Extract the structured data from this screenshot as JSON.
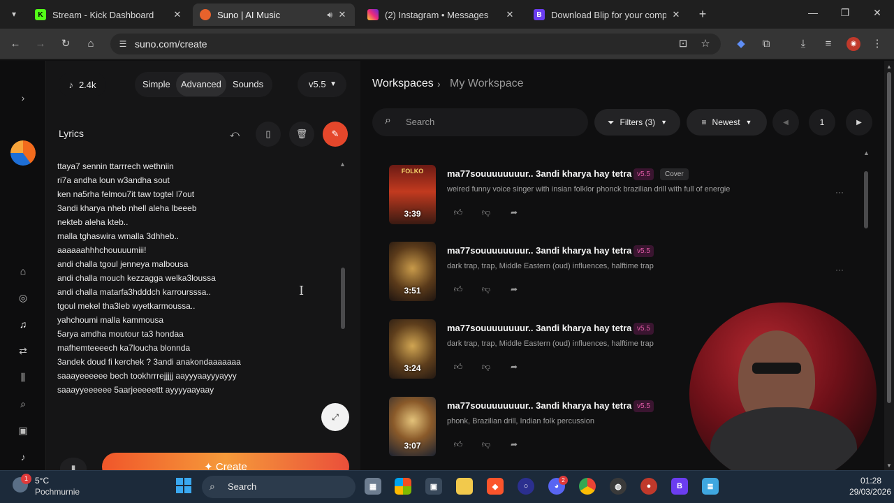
{
  "browser": {
    "tabs": [
      {
        "title": "Stream - Kick Dashboard",
        "favicon": "K",
        "color": "#53fc18"
      },
      {
        "title": "Suno | AI Music",
        "favicon": "suno",
        "color": "#e8622c",
        "active": true
      },
      {
        "title": "(2) Instagram • Messages",
        "favicon": "ig",
        "color": "#d6249f"
      },
      {
        "title": "Download Blip for your comput",
        "favicon": "B",
        "color": "#6b3df0"
      }
    ],
    "url": "suno.com/create"
  },
  "create": {
    "credits": "2.4k",
    "modes": [
      "Simple",
      "Advanced",
      "Sounds"
    ],
    "selected_mode": "Advanced",
    "version": "v5.5",
    "lyrics_label": "Lyrics",
    "lyrics_lines": [
      "ttaya7 sennin ttarrrech wethniin",
      "ri7a andha loun w3andha sout",
      "ken na5rha felmou7it taw togtel l7out",
      "3andi kharya nheb nhell aleha lbeeeb",
      "nekteb aleha kteb..",
      "malla tghaswira wmalla 3dhheb..",
      "aaaaaahhhchouuuumiii!",
      "andi challa tgoul jenneya malbousa",
      "andi challa mouch kezzagga welka3loussa",
      "andi challa matarfa3hdddch karroursssa..",
      "tgoul mekel tha3leb wyetkarmoussa..",
      "yahchoumi malla kammousa",
      "5arya amdha moutour ta3 hondaa",
      "mafhemteeeech ka7loucha blonnda",
      "3andek doud fi kerchek ? 3andi anakondaaaaaaa",
      "saaayeeeeee bech tookhrrrejjjjj aayyyaayyyayyy",
      "saaayyeeeeee 5aarjeeeeettt ayyyyaayaay"
    ],
    "create_label": "Create"
  },
  "workspace": {
    "breadcrumb_root": "Workspaces",
    "breadcrumb_current": "My Workspace",
    "search_placeholder": "Search",
    "filters_label": "Filters (3)",
    "sort_label": "Newest",
    "page": "1",
    "songs": [
      {
        "title": "ma77souuuuuuuur.. 3andi kharya hay tetra",
        "version": "v5.5",
        "tag": "Cover",
        "desc": "weired funny voice singer with insian folklor phonck brazilian drill with full of energie",
        "duration": "3:39",
        "cover_label": "FOLKO"
      },
      {
        "title": "ma77souuuuuuuur.. 3andi kharya hay tetra",
        "version": "v5.5",
        "tag": "",
        "desc": "dark trap, trap, Middle Eastern (oud) influences, halftime trap",
        "duration": "3:51"
      },
      {
        "title": "ma77souuuuuuuur.. 3andi kharya hay tetra",
        "version": "v5.5",
        "tag": "",
        "desc": "dark trap, trap, Middle Eastern (oud) influences, halftime trap",
        "duration": "3:24"
      },
      {
        "title": "ma77souuuuuuuur.. 3andi kharya hay tetra",
        "version": "v5.5",
        "tag": "",
        "desc": "phonk, Brazilian drill, Indian folk percussion",
        "duration": "3:07"
      }
    ]
  },
  "taskbar": {
    "weather_badge": "1",
    "temperature": "5°C",
    "location": "Pochmurnie",
    "search_placeholder": "Search",
    "discord_badge": "2",
    "time": "01:28",
    "date": "29/03/2026"
  },
  "colors": {
    "accent": "#e5472b",
    "version_tag": "#e05aa6"
  }
}
